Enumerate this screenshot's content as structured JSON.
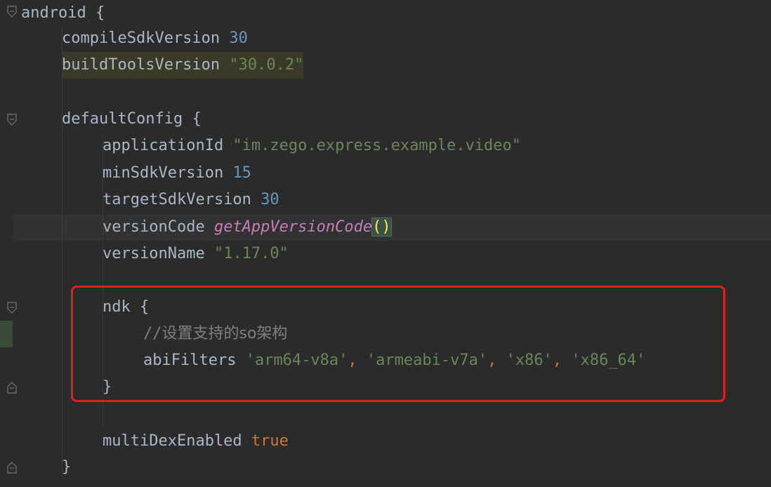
{
  "editor": {
    "lines": [
      {
        "id": "l1",
        "tokens": [
          {
            "t": "android ",
            "c": "plain"
          },
          {
            "t": "{",
            "c": "plain"
          }
        ]
      },
      {
        "id": "l2",
        "tokens": [
          {
            "t": "compileSdkVersion ",
            "c": "plain"
          },
          {
            "t": "30",
            "c": "num"
          }
        ]
      },
      {
        "id": "l3",
        "tokens": [
          {
            "t": "buildToolsVersion ",
            "c": "plain"
          },
          {
            "t": "\"30.0.2\"",
            "c": "str"
          }
        ]
      },
      {
        "id": "l4",
        "tokens": []
      },
      {
        "id": "l5",
        "tokens": [
          {
            "t": "defaultConfig ",
            "c": "plain"
          },
          {
            "t": "{",
            "c": "plain"
          }
        ]
      },
      {
        "id": "l6",
        "tokens": [
          {
            "t": "applicationId ",
            "c": "plain"
          },
          {
            "t": "\"im.zego.express.example.video\"",
            "c": "str"
          }
        ]
      },
      {
        "id": "l7",
        "tokens": [
          {
            "t": "minSdkVersion ",
            "c": "plain"
          },
          {
            "t": "15",
            "c": "num"
          }
        ]
      },
      {
        "id": "l8",
        "tokens": [
          {
            "t": "targetSdkVersion ",
            "c": "plain"
          },
          {
            "t": "30",
            "c": "num"
          }
        ]
      },
      {
        "id": "l9",
        "tokens": [
          {
            "t": "versionCode ",
            "c": "plain"
          },
          {
            "t": "getAppVersionCode",
            "c": "fn"
          },
          {
            "t": "()",
            "c": "paren"
          }
        ]
      },
      {
        "id": "l10",
        "tokens": [
          {
            "t": "versionName ",
            "c": "plain"
          },
          {
            "t": "\"1.17.0\"",
            "c": "str"
          }
        ]
      },
      {
        "id": "l11",
        "tokens": []
      },
      {
        "id": "l12",
        "tokens": [
          {
            "t": "ndk ",
            "c": "plain"
          },
          {
            "t": "{",
            "c": "plain"
          }
        ]
      },
      {
        "id": "l13",
        "tokens": [
          {
            "t": "//",
            "c": "cmt"
          },
          {
            "t": "设置支持的so架构",
            "c": "cmtcjk"
          }
        ]
      },
      {
        "id": "l14",
        "tokens": [
          {
            "t": "abiFilters ",
            "c": "plain"
          },
          {
            "t": "'arm64-v8a'",
            "c": "str"
          },
          {
            "t": ", ",
            "c": "kw"
          },
          {
            "t": "'armeabi-v7a'",
            "c": "str"
          },
          {
            "t": ", ",
            "c": "kw"
          },
          {
            "t": "'x86'",
            "c": "str"
          },
          {
            "t": ", ",
            "c": "kw"
          },
          {
            "t": "'x86_64'",
            "c": "str"
          }
        ]
      },
      {
        "id": "l15",
        "tokens": [
          {
            "t": "}",
            "c": "plain"
          }
        ]
      },
      {
        "id": "l16",
        "tokens": []
      },
      {
        "id": "l17",
        "tokens": [
          {
            "t": "multiDexEnabled ",
            "c": "plain"
          },
          {
            "t": "true",
            "c": "kw"
          }
        ]
      },
      {
        "id": "l18",
        "tokens": [
          {
            "t": "}",
            "c": "plain"
          }
        ]
      }
    ]
  },
  "gutter": {
    "fold_icons": [
      "fold-open-icon",
      "fold-open-icon",
      "fold-open-icon",
      "fold-close-icon",
      "fold-close-icon"
    ]
  },
  "colors": {
    "background": "#2b2b2b",
    "plain": "#a9b7c6",
    "keyword": "#cc7832",
    "number": "#6897bb",
    "string": "#6a8759",
    "function": "#c77dbb",
    "comment": "#808080",
    "annotation_box": "#e0201c"
  }
}
